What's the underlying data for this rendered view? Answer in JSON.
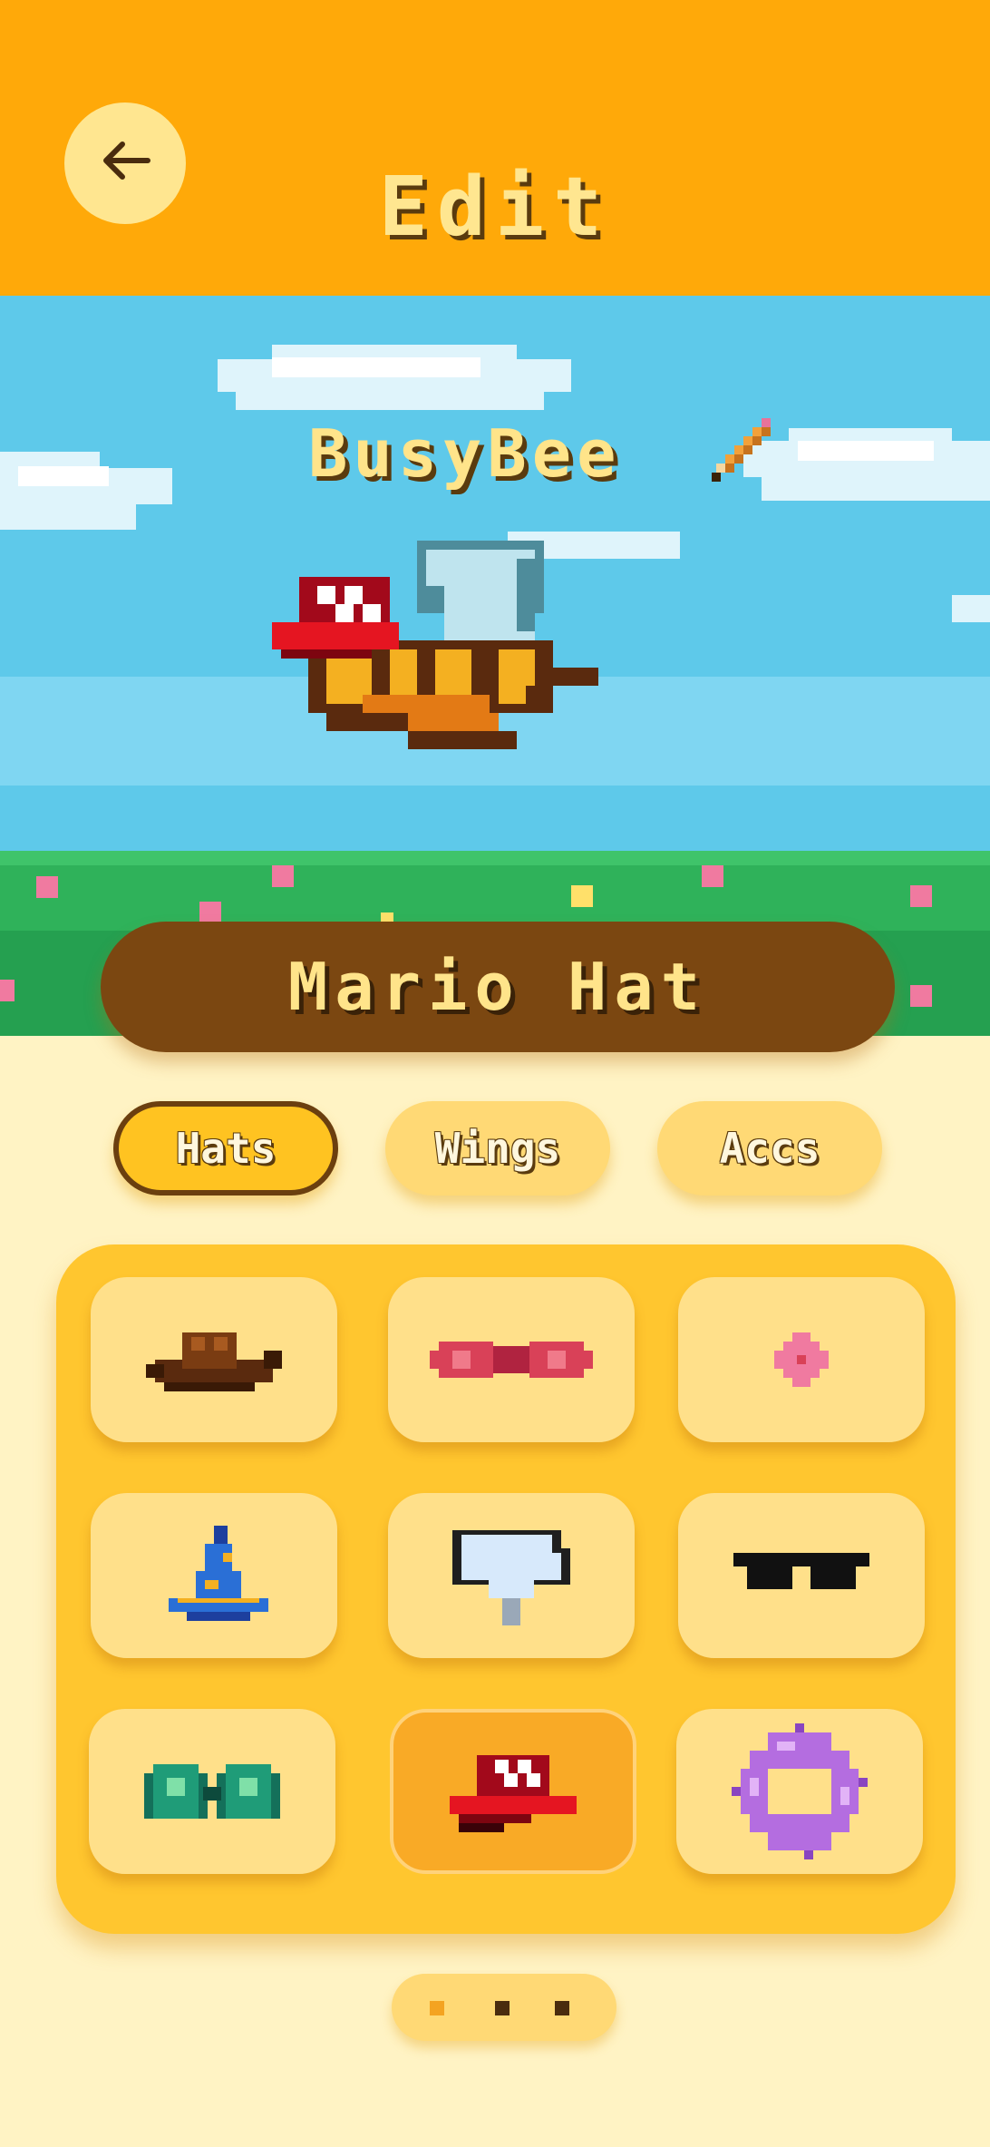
{
  "header": {
    "title": "Edit",
    "back_icon": "arrow-left-icon"
  },
  "bee": {
    "name": "BusyBee",
    "edit_icon": "pencil-icon",
    "equipped": "mario-hat"
  },
  "selected_item": {
    "name": "Mario Hat"
  },
  "tabs": [
    {
      "label": "Hats",
      "active": true
    },
    {
      "label": "Wings",
      "active": false
    },
    {
      "label": "Accs",
      "active": false
    }
  ],
  "items": [
    {
      "icon": "cowboy-hat-icon",
      "selected": false
    },
    {
      "icon": "bow-tie-icon",
      "selected": false
    },
    {
      "icon": "flower-icon",
      "selected": false
    },
    {
      "icon": "wizard-hat-icon",
      "selected": false
    },
    {
      "icon": "chef-hat-icon",
      "selected": false
    },
    {
      "icon": "sunglasses-icon",
      "selected": false
    },
    {
      "icon": "green-goggles-icon",
      "selected": false
    },
    {
      "icon": "mario-hat-icon",
      "selected": true
    },
    {
      "icon": "flower-crown-icon",
      "selected": false
    }
  ],
  "pager": {
    "pages": 3,
    "current": 1
  },
  "colors": {
    "header": "#ffa909",
    "accent_brown": "#7b4711",
    "panel": "#ffc62f",
    "slot": "#ffe08a",
    "slot_selected": "#f9aa26",
    "sky": "#5ec9ea",
    "grass": "#2fb25a"
  }
}
